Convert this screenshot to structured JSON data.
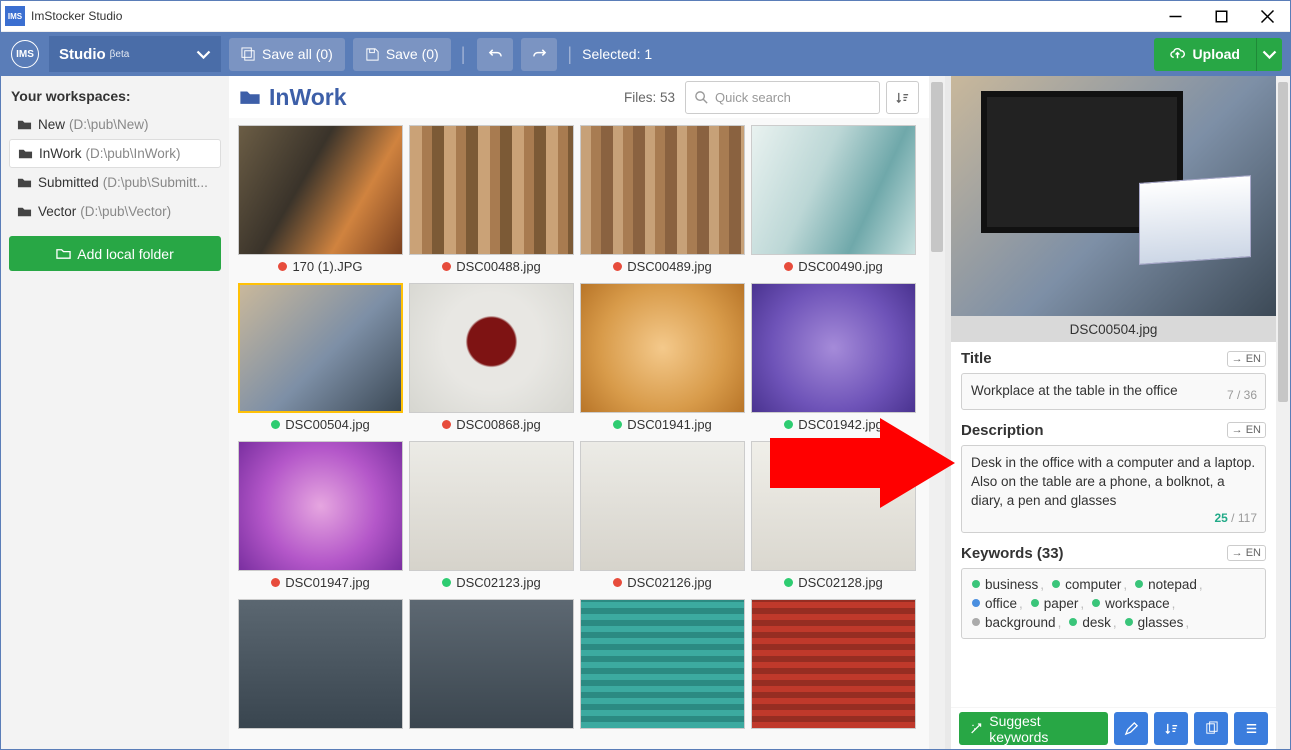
{
  "window": {
    "title": "ImStocker Studio",
    "icon_text": "IMS"
  },
  "appbar": {
    "logo": "IMS",
    "studio_label": "Studio",
    "beta_label": "βeta",
    "save_all": "Save all (0)",
    "save": "Save (0)",
    "selected_label": "Selected: 1",
    "upload_label": "Upload"
  },
  "sidebar": {
    "heading": "Your workspaces:",
    "items": [
      {
        "name": "New",
        "path": "(D:\\pub\\New)",
        "active": false
      },
      {
        "name": "InWork",
        "path": "(D:\\pub\\InWork)",
        "active": true
      },
      {
        "name": "Submitted",
        "path": "(D:\\pub\\Submitt...",
        "active": false
      },
      {
        "name": "Vector",
        "path": "(D:\\pub\\Vector)",
        "active": false
      }
    ],
    "add_folder_label": "Add local folder"
  },
  "gallery": {
    "folder_name": "InWork",
    "files_label": "Files: 53",
    "search_placeholder": "Quick search",
    "thumbs": [
      {
        "file": "170 (1).JPG",
        "status": "r",
        "bg": "linear-gradient(120deg,#6b5d45,#3a332a 40%,#d0833f 70%,#7b4120)"
      },
      {
        "file": "DSC00488.jpg",
        "status": "r",
        "bg": "repeating-linear-gradient(90deg,#caa277 0 12px,#a87b50 12px 22px,#7c5a36 22px 34px)"
      },
      {
        "file": "DSC00489.jpg",
        "status": "r",
        "bg": "repeating-linear-gradient(90deg,#c7a178 0 10px,#a87c52 10px 20px,#8a6240 20px 32px)"
      },
      {
        "file": "DSC00490.jpg",
        "status": "r",
        "bg": "linear-gradient(115deg,#e9f2f0,#bcd7d6 40%,#6fa8aa 70%,#c9e2e0)"
      },
      {
        "file": "DSC00504.jpg",
        "status": "g",
        "sel": true,
        "bg": "linear-gradient(135deg,#c9b89b,#7d8fa6 55%,#3c4956)"
      },
      {
        "file": "DSC00868.jpg",
        "status": "r",
        "bg": "radial-gradient(circle at 50% 45%,#7e1313 0 22%,#e8e7e3 24% 45%,#d6d6d0 100%)"
      },
      {
        "file": "DSC01941.jpg",
        "status": "g",
        "bg": "radial-gradient(circle,#f4c98b,#d89b4a 60%,#b87528)"
      },
      {
        "file": "DSC01942.jpg",
        "status": "g",
        "bg": "radial-gradient(circle,#a58bd9,#6e53b8 60%,#4a3390)"
      },
      {
        "file": "DSC01947.jpg",
        "status": "r",
        "bg": "radial-gradient(circle,#e6a6e0,#b457c9 55%,#7a2fa0)"
      },
      {
        "file": "DSC02123.jpg",
        "status": "g",
        "bg": "linear-gradient(#ecebe6,#d6d3cb)"
      },
      {
        "file": "DSC02126.jpg",
        "status": "r",
        "bg": "linear-gradient(#ecebe6,#d6d3cb)"
      },
      {
        "file": "DSC02128.jpg",
        "status": "g",
        "bg": "linear-gradient(#f0efe9,#dad7cf)"
      },
      {
        "file": "",
        "status": "",
        "bg": "linear-gradient(#5b6771,#39454f)"
      },
      {
        "file": "",
        "status": "",
        "bg": "linear-gradient(#5d6872,#3b464f)"
      },
      {
        "file": "",
        "status": "",
        "bg": "repeating-linear-gradient(0deg,#3caaa0 0 6px,#2b8a82 6px 12px)"
      },
      {
        "file": "",
        "status": "",
        "bg": "repeating-linear-gradient(0deg,#c0392b 0 6px,#962d22 6px 12px)"
      }
    ]
  },
  "detail": {
    "filename": "DSC00504.jpg",
    "title_label": "Title",
    "title_value": "Workplace at the table in the office",
    "title_count_cur": "7",
    "title_count_max": "36",
    "desc_label": "Description",
    "desc_value": "Desk in the office with a computer and a laptop. Also on the table are a phone, a bolknot, a diary, a pen and glasses",
    "desc_count_cur": "25",
    "desc_count_max": "117",
    "keywords_label": "Keywords (33)",
    "lang_btn": "→ EN",
    "keywords": [
      {
        "w": "business",
        "c": "gn"
      },
      {
        "w": "computer",
        "c": "gn"
      },
      {
        "w": "notepad",
        "c": "gn"
      },
      {
        "w": "office",
        "c": "bl"
      },
      {
        "w": "paper",
        "c": "gn"
      },
      {
        "w": "workspace",
        "c": "gn"
      },
      {
        "w": "background",
        "c": "gy"
      },
      {
        "w": "desk",
        "c": "gn"
      },
      {
        "w": "glasses",
        "c": "gn"
      }
    ],
    "suggest_label": "Suggest keywords"
  }
}
